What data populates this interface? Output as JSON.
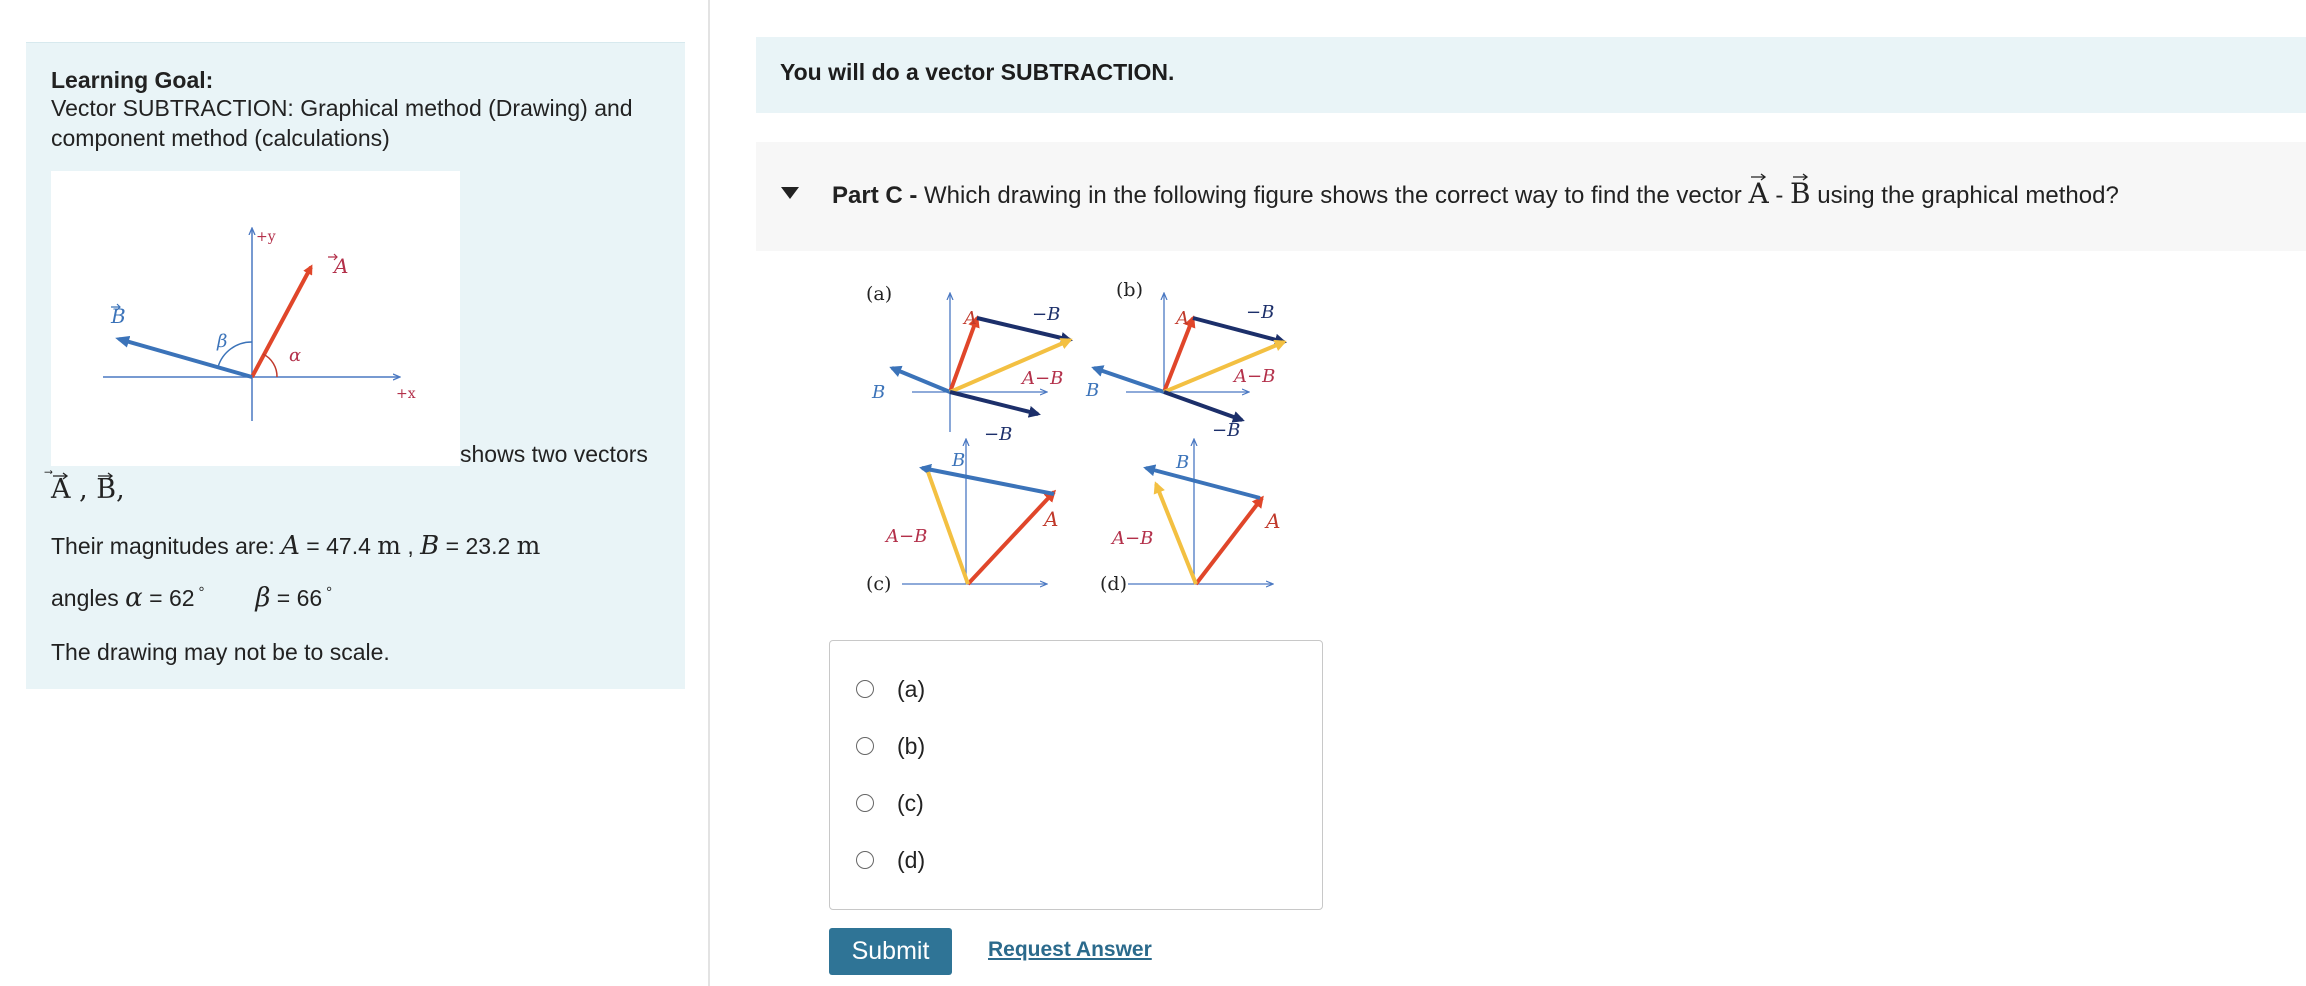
{
  "learning_goal": {
    "title": "Learning Goal:",
    "description": "Vector SUBTRACTION: Graphical method (Drawing)  and component method (calculations)",
    "shows_text": "shows two vectors",
    "vector_A": "A",
    "vector_B": "B",
    "magnitudes_prefix": "Their magnitudes are:",
    "A_symbol": "A",
    "A_value": "47.4",
    "A_unit": "m",
    "B_symbol": "B",
    "B_value": "23.2",
    "B_unit": "m",
    "angles_prefix": "angles",
    "alpha_symbol": "α",
    "alpha_value": "62",
    "beta_symbol": "β",
    "beta_value": "66",
    "degree": "°",
    "scale_note": "The drawing may not be to scale.",
    "figure_labels": {
      "plus_y": "+y",
      "plus_x": "+x",
      "A": "A",
      "B": "B",
      "alpha": "α",
      "beta": "β"
    }
  },
  "task_banner": {
    "text": "You will do a vector SUBTRACTION."
  },
  "part": {
    "label": "Part C -",
    "question_start": "Which drawing in the following figure shows the correct way to find the vector",
    "vec_A": "A",
    "minus": "-",
    "vec_B": "B",
    "question_end": "using the graphical method?"
  },
  "figure": {
    "panel_labels": [
      "(a)",
      "(b)",
      "(c)",
      "(d)"
    ],
    "A": "A",
    "B": "B",
    "minus_B": "−B",
    "A_minus_B": "A−B"
  },
  "colors": {
    "A_vector": "#e0462a",
    "B_vector": "#3b73b9",
    "minus_B": "#1c2f6a",
    "A_minus_B": "#f3c042",
    "axis": "#4a78c2"
  },
  "options": [
    "(a)",
    "(b)",
    "(c)",
    "(d)"
  ],
  "selected_option": null,
  "buttons": {
    "submit": "Submit",
    "request_answer": "Request Answer"
  }
}
